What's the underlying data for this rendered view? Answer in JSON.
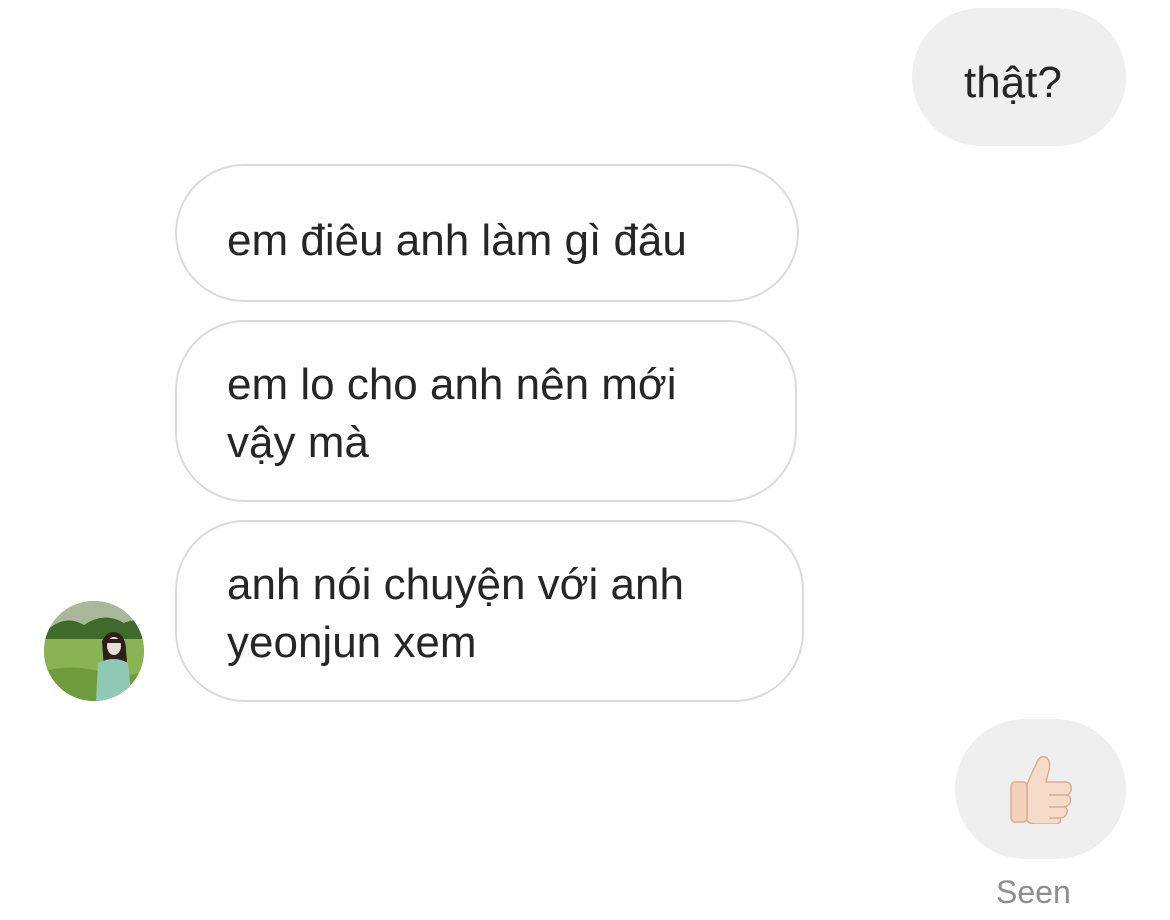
{
  "messages": [
    {
      "direction": "outgoing",
      "text": "thật?"
    },
    {
      "direction": "incoming",
      "text": "em điêu anh làm gì đâu"
    },
    {
      "direction": "incoming",
      "lines": [
        "em lo cho anh nên mới",
        "vậy mà"
      ]
    },
    {
      "direction": "incoming",
      "lines": [
        "anh nói chuyện với anh",
        "yeonjun xem"
      ]
    }
  ],
  "reaction": {
    "icon": "thumbs-up-icon",
    "emoji": "👍🏻"
  },
  "status": {
    "seen_label": "Seen"
  },
  "colors": {
    "outgoing_bubble": "#efefef",
    "incoming_border": "#dbdbdb",
    "text": "#262626",
    "muted": "#8e8e8e"
  }
}
